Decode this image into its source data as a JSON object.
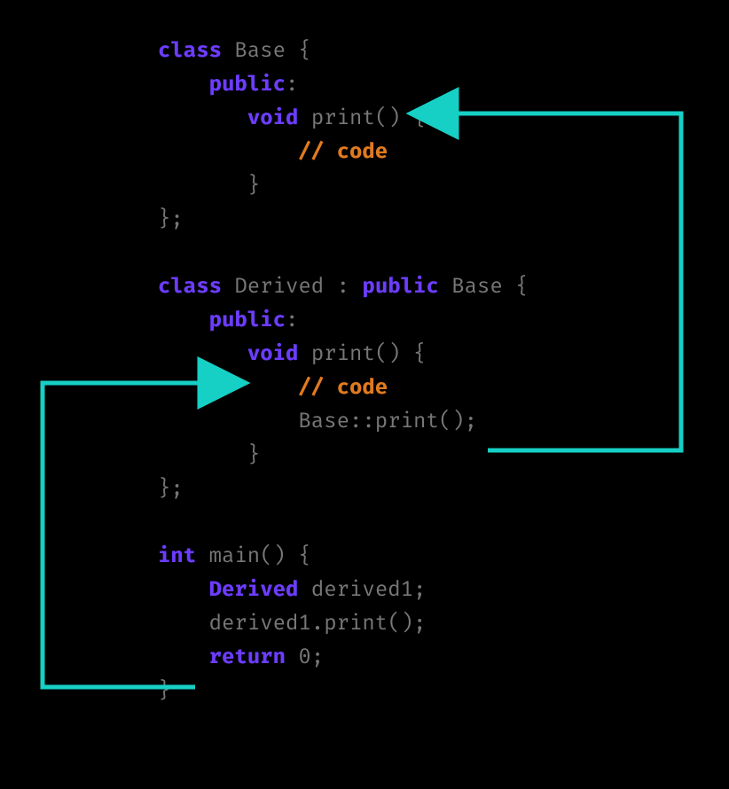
{
  "code": {
    "l1": {
      "kw_class": "class",
      "name": "Base",
      "brace": " {"
    },
    "l2": {
      "kw_public": "public",
      "colon": ":"
    },
    "l3": {
      "kw_void": "void",
      "fn": "print()",
      "brace": " {"
    },
    "l4": {
      "cmt": "// code"
    },
    "l5": {
      "brace": "}"
    },
    "l6": {
      "brace": "};"
    },
    "l7": "",
    "l8": {
      "kw_class": "class",
      "name": "Derived",
      "sep": " : ",
      "kw_public": "public",
      "base": " Base",
      "brace": " {"
    },
    "l9": {
      "kw_public": "public",
      "colon": ":"
    },
    "l10": {
      "kw_void": "void",
      "fn": "print()",
      "brace": " {"
    },
    "l11": {
      "cmt": "// code"
    },
    "l12": {
      "call": "Base::print();"
    },
    "l13": {
      "brace": "}"
    },
    "l14": {
      "brace": "};"
    },
    "l15": "",
    "l16": {
      "kw_int": "int",
      "fn": "main()",
      "brace": " {"
    },
    "l17": {
      "type": "Derived",
      "var": " derived1;"
    },
    "l18": {
      "stmt": "derived1.print();"
    },
    "l19": {
      "kw_return": "return",
      "val": " 0;"
    },
    "l20": {
      "brace": "}"
    }
  },
  "arrows": {
    "color": "#16d0c5",
    "arrow1_desc": "from derived1.print() call in main() to Derived::print() definition",
    "arrow2_desc": "from Base::print() call inside Derived::print() to Base::print() definition"
  }
}
